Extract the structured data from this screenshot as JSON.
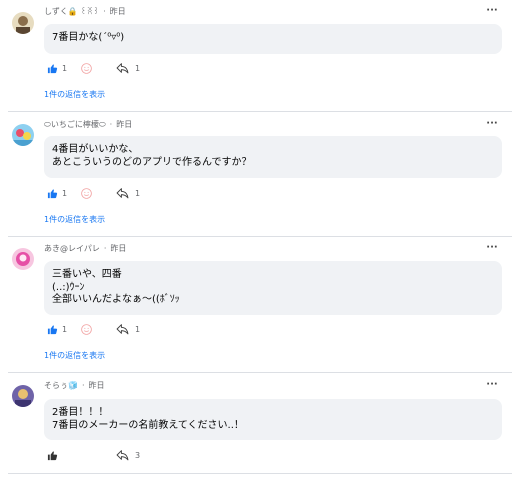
{
  "comments": [
    {
      "author": "しずく🔒 ꒰ꐦ꒱",
      "time": "昨日",
      "lines": [
        "7番目かな(´⁰▿⁰)"
      ],
      "like_count": "1",
      "share_count": "1",
      "replies_label": "1件の返信を表示",
      "avatar_color": "#d9c9a3"
    },
    {
      "author": "⬭いちごに檸檬⬭",
      "time": "昨日",
      "lines": [
        "4番目がいいかな、",
        "あとこういうのどのアプリで作るんですか？"
      ],
      "like_count": "1",
      "share_count": "1",
      "replies_label": "1件の返信を表示",
      "avatar_color": "#6ab0d8"
    },
    {
      "author": "あき@レイパレ",
      "time": "昨日",
      "lines": [
        "三番いや、四番",
        "(..:)ｳｰﾝ",
        "全部いいんだよなぁ〜((ﾎﾞｿｯ"
      ],
      "like_count": "1",
      "share_count": "1",
      "replies_label": "1件の返信を表示",
      "avatar_color": "#e86fb5"
    },
    {
      "author": "そらぅ🧊",
      "time": "昨日",
      "lines": [
        "2番目！！！",
        "7番目のメーカーの名前教えてください..！"
      ],
      "like_count": "",
      "share_count": "3",
      "replies_label": "",
      "avatar_color": "#7a6fb0"
    }
  ],
  "colors": {
    "like_blue": "#1877f2",
    "link_blue": "#1877f2",
    "bubble_bg": "#f0f2f5",
    "muted_text": "#65676b"
  },
  "icons": [
    "thumbs-up-icon",
    "reaction-smiley-icon",
    "share-arrow-icon",
    "more-options-icon"
  ]
}
